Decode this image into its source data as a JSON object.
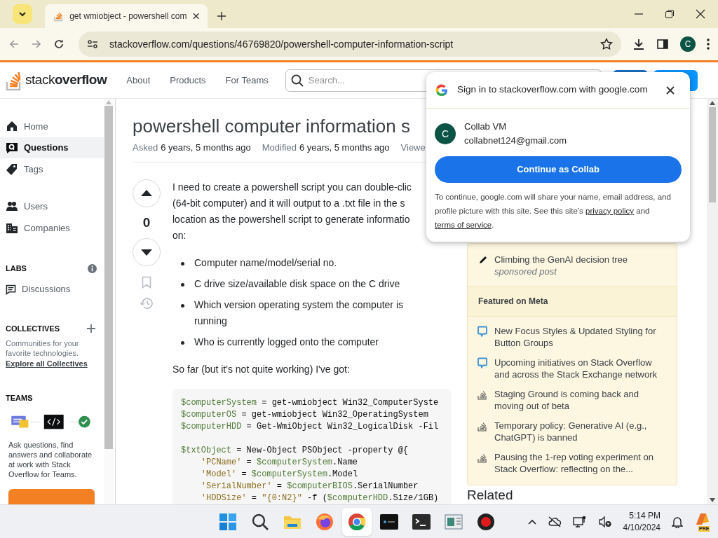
{
  "browser": {
    "tab_title": "get wmiobject - powershell com",
    "address": "stackoverflow.com/questions/46769820/powershell-computer-information-script",
    "profile_initial": "C"
  },
  "site_header": {
    "logo_parts": [
      "stack",
      "overflow"
    ],
    "nav": [
      "About",
      "Products",
      "For Teams"
    ],
    "search_placeholder": "Search..."
  },
  "left_nav": {
    "primary_items": [
      {
        "label": "Home",
        "selected": false
      },
      {
        "label": "Questions",
        "selected": true
      },
      {
        "label": "Tags",
        "selected": false
      }
    ],
    "secondary_items": [
      {
        "label": "Users",
        "selected": false
      },
      {
        "label": "Companies",
        "selected": false
      }
    ],
    "labs": {
      "heading": "LABS",
      "items": [
        "Discussions"
      ]
    },
    "collectives": {
      "heading": "COLLECTIVES",
      "text": "Communities for your favorite technologies.",
      "link": "Explore all Collectives"
    },
    "teams": {
      "heading": "TEAMS",
      "text": "Ask questions, find answers and collaborate at work with Stack Overflow for Teams."
    }
  },
  "question": {
    "title": "powershell computer information s",
    "meta": [
      {
        "label": "Asked",
        "value": "6 years, 5 months ago"
      },
      {
        "label": "Modified",
        "value": "6 years, 5 months ago"
      },
      {
        "label": "Viewe"
      }
    ],
    "votes": "0",
    "intro_lines": [
      "I need to create a powershell script you can double-clic",
      "(64-bit computer) and it will output to a .txt file in the s",
      "location as the powershell script to generate informatio",
      "on:"
    ],
    "bullets": [
      "Computer name/model/serial no.",
      "C drive size/available disk space on the C drive",
      "Which version operating system the computer is running",
      "Who is currently logged onto the computer"
    ],
    "after": "So far (but it's not quite working) I've got:",
    "code": [
      [
        "$computerSystem = get-wmiobject Win32_ComputerSyste",
        "$computerOS = get-wmiobject Win32_OperatingSystem",
        "$computerHDD = Get-WmiObject Win32_LogicalDisk -Fil"
      ],
      [
        "$txtObject = New-Object PSObject -property @{",
        "    'PCName' = $computerSystem.Name",
        "    'Model' = $computerSystem.Model",
        "    'SerialNumber' = $computerBIOS.SerialNumber",
        "    'HDDSize' = \"{0:N2}\" -f ($computerHDD.Size/1GB)"
      ]
    ]
  },
  "right_sidebar": {
    "blog_items": [
      {
        "text": "Climbing the GenAI decision tree",
        "note": "sponsored post"
      }
    ],
    "featured_heading": "Featured on Meta",
    "featured_items": [
      {
        "kind": "meta",
        "text": "New Focus Styles & Updated Styling for Button Groups"
      },
      {
        "kind": "meta",
        "text": "Upcoming initiatives on Stack Overflow and across the Stack Exchange network"
      },
      {
        "kind": "so",
        "text": "Staging Ground is coming back and moving out of beta"
      },
      {
        "kind": "so",
        "text": "Temporary policy: Generative AI (e.g., ChatGPT) is banned"
      },
      {
        "kind": "so",
        "text": "Pausing the 1-rep voting experiment on Stack Overflow: reflecting on the..."
      }
    ],
    "related_heading": "Related"
  },
  "popup": {
    "title": "Sign in to stackoverflow.com with google.com",
    "account_initial": "C",
    "account_name": "Collab VM",
    "account_email": "collabnet124@gmail.com",
    "button": "Continue as Collab",
    "notice": "To continue, google.com will share your name, email address, and profile picture with this site. See this site's ",
    "privacy_link": "privacy policy",
    "notice_and": " and ",
    "terms_link": "terms of service",
    "notice_end": "."
  },
  "taskbar": {
    "apps": [
      {
        "kind": "start",
        "selected": false
      },
      {
        "kind": "search",
        "selected": false
      },
      {
        "kind": "files",
        "selected": false
      },
      {
        "kind": "firefox",
        "selected": false
      },
      {
        "kind": "chrome",
        "selected": true
      },
      {
        "kind": "console",
        "selected": false
      },
      {
        "kind": "terminal",
        "selected": false
      },
      {
        "kind": "window",
        "selected": false
      },
      {
        "kind": "record",
        "selected": false
      }
    ],
    "time": "5:14 PM",
    "date": "4/10/2024",
    "badge": "PRE"
  }
}
